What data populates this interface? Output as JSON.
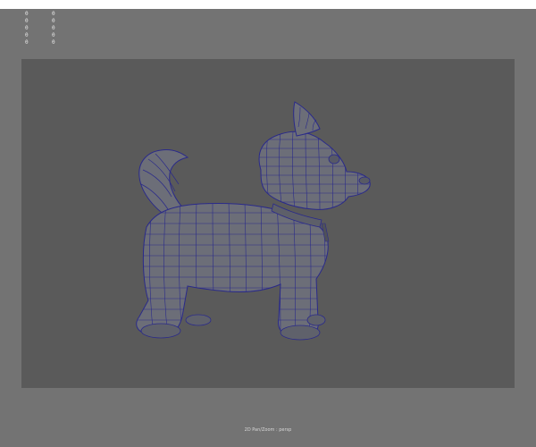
{
  "hud": {
    "rows": [
      {
        "a": "0",
        "b": "0"
      },
      {
        "a": "0",
        "b": "0"
      },
      {
        "a": "0",
        "b": "0"
      },
      {
        "a": "0",
        "b": "0"
      },
      {
        "a": "0",
        "b": "0"
      }
    ]
  },
  "viewport": {
    "camera_label": "2D Pan/Zoom : persp",
    "background_color": "#5a5a5a",
    "wireframe_color": "#2a2a8a",
    "model": "dog-model"
  }
}
